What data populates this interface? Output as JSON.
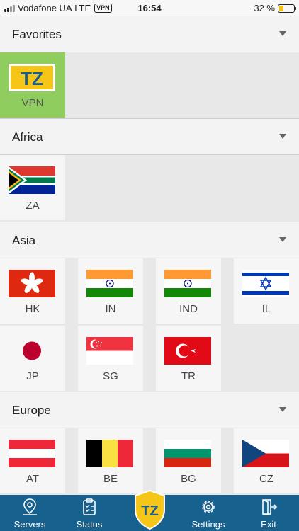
{
  "status_bar": {
    "carrier": "Vodafone UA",
    "network": "LTE",
    "vpn_badge": "VPN",
    "time": "16:54",
    "battery": "32 %",
    "battery_level": 0.32
  },
  "sections": [
    {
      "title": "Favorites",
      "items": [
        {
          "code": "VPN",
          "icon": "tz-logo-icon"
        }
      ]
    },
    {
      "title": "Africa",
      "items": [
        {
          "code": "ZA",
          "icon": "south-africa-flag-icon"
        }
      ]
    },
    {
      "title": "Asia",
      "items": [
        {
          "code": "HK",
          "icon": "hong-kong-flag-icon"
        },
        {
          "code": "IN",
          "icon": "india-flag-icon"
        },
        {
          "code": "IND",
          "icon": "india-flag-icon"
        },
        {
          "code": "IL",
          "icon": "israel-flag-icon"
        },
        {
          "code": "JP",
          "icon": "japan-flag-icon"
        },
        {
          "code": "SG",
          "icon": "singapore-flag-icon"
        },
        {
          "code": "TR",
          "icon": "turkey-flag-icon"
        }
      ]
    },
    {
      "title": "Europe",
      "items": [
        {
          "code": "AT",
          "icon": "austria-flag-icon"
        },
        {
          "code": "BE",
          "icon": "belgium-flag-icon"
        },
        {
          "code": "BG",
          "icon": "bulgaria-flag-icon"
        },
        {
          "code": "CZ",
          "icon": "czech-flag-icon"
        }
      ]
    }
  ],
  "tabs": [
    {
      "label": "Servers",
      "icon": "map-pin-icon"
    },
    {
      "label": "Status",
      "icon": "clipboard-icon"
    },
    {
      "label": "Settings",
      "icon": "gear-icon"
    },
    {
      "label": "Exit",
      "icon": "exit-door-icon"
    }
  ],
  "colors": {
    "tab_bar": "#16618e",
    "selected_tile": "#8fce5e",
    "logo_yellow": "#f5c518"
  }
}
